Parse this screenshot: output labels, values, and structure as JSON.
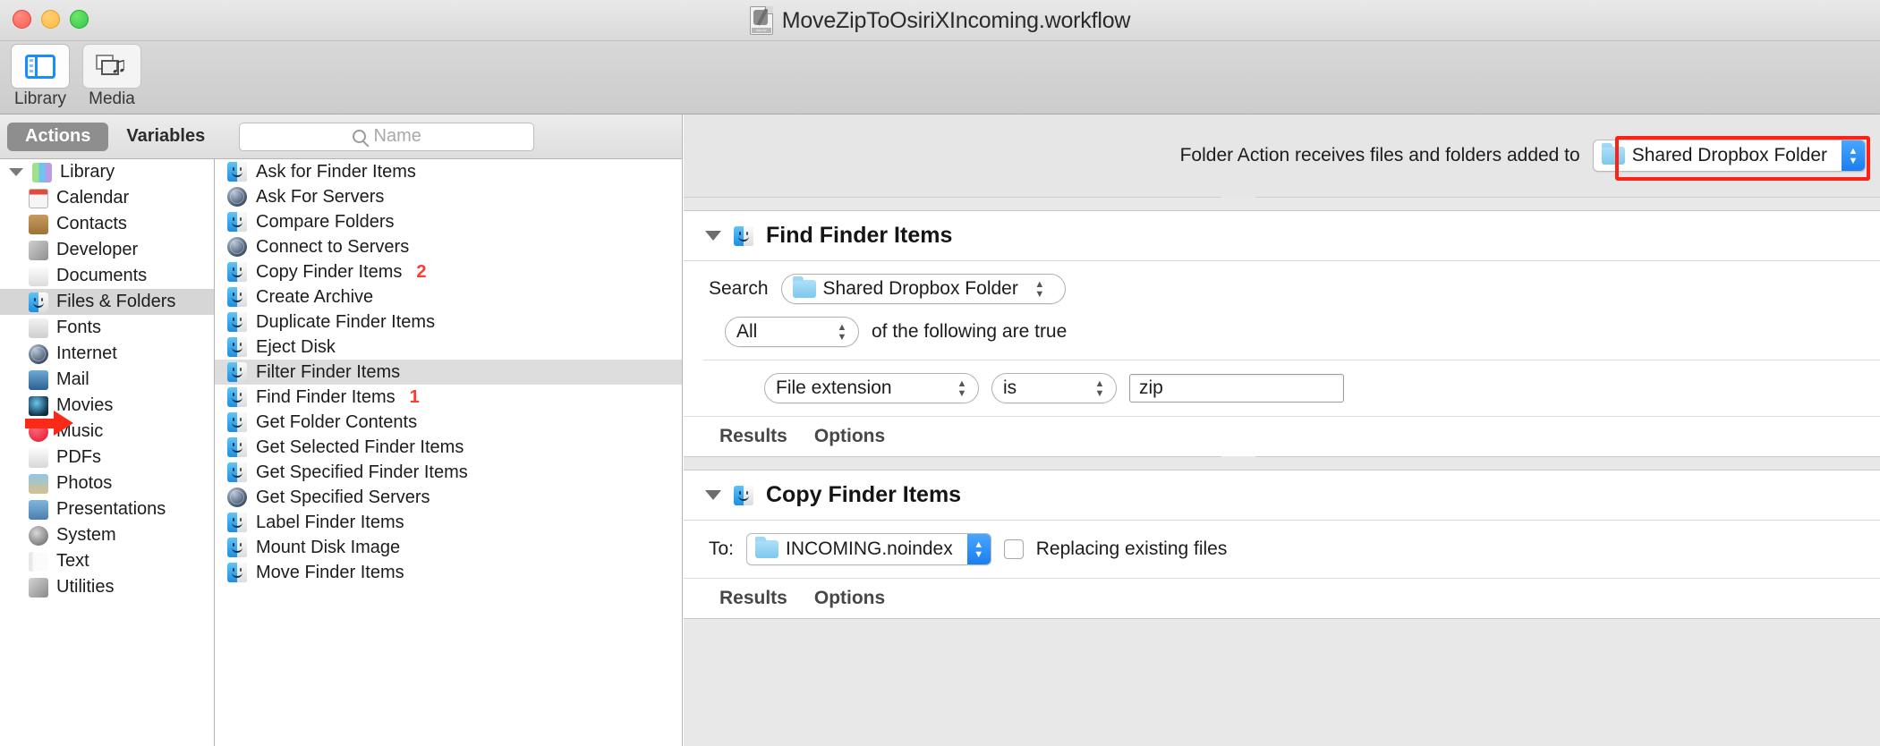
{
  "window": {
    "title": "MoveZipToOsiriXIncoming.workflow",
    "doc_icon": "workflow-document-icon",
    "traffic_lights": [
      "close-button",
      "minimize-button",
      "zoom-button"
    ]
  },
  "toolbar": {
    "items": [
      {
        "label": "Library",
        "icon": "library-panel-icon",
        "active": true
      },
      {
        "label": "Media",
        "icon": "media-browser-icon",
        "active": false
      }
    ]
  },
  "library": {
    "tabs": [
      {
        "label": "Actions",
        "selected": true
      },
      {
        "label": "Variables",
        "selected": false
      }
    ],
    "search": {
      "placeholder": "Name",
      "value": "",
      "icon": "search-icon"
    },
    "categories": [
      {
        "label": "Library",
        "icon": "library-books-icon",
        "root": true,
        "selected": false
      },
      {
        "label": "Calendar",
        "icon": "calendar-icon",
        "selected": false
      },
      {
        "label": "Contacts",
        "icon": "contacts-icon",
        "selected": false
      },
      {
        "label": "Developer",
        "icon": "developer-tools-icon",
        "selected": false
      },
      {
        "label": "Documents",
        "icon": "documents-icon",
        "selected": false
      },
      {
        "label": "Files & Folders",
        "icon": "finder-icon",
        "selected": true,
        "pointer": true
      },
      {
        "label": "Fonts",
        "icon": "fonts-icon",
        "selected": false
      },
      {
        "label": "Internet",
        "icon": "globe-icon",
        "selected": false
      },
      {
        "label": "Mail",
        "icon": "mail-photo-icon",
        "selected": false
      },
      {
        "label": "Movies",
        "icon": "quicktime-icon",
        "selected": false
      },
      {
        "label": "Music",
        "icon": "itunes-icon",
        "selected": false
      },
      {
        "label": "PDFs",
        "icon": "pdf-icon",
        "selected": false
      },
      {
        "label": "Photos",
        "icon": "photos-icon",
        "selected": false
      },
      {
        "label": "Presentations",
        "icon": "keynote-icon",
        "selected": false
      },
      {
        "label": "System",
        "icon": "system-prefs-icon",
        "selected": false
      },
      {
        "label": "Text",
        "icon": "textedit-icon",
        "selected": false
      },
      {
        "label": "Utilities",
        "icon": "utilities-icon",
        "selected": false
      }
    ],
    "actions": [
      {
        "label": "Ask for Finder Items",
        "icon": "finder-icon",
        "selected": false,
        "mark": ""
      },
      {
        "label": "Ask For Servers",
        "icon": "globe-icon",
        "selected": false,
        "mark": ""
      },
      {
        "label": "Compare Folders",
        "icon": "finder-icon",
        "selected": false,
        "mark": ""
      },
      {
        "label": "Connect to Servers",
        "icon": "globe-icon",
        "selected": false,
        "mark": ""
      },
      {
        "label": "Copy Finder Items",
        "icon": "finder-icon",
        "selected": false,
        "mark": "2"
      },
      {
        "label": "Create Archive",
        "icon": "finder-icon",
        "selected": false,
        "mark": ""
      },
      {
        "label": "Duplicate Finder Items",
        "icon": "finder-icon",
        "selected": false,
        "mark": ""
      },
      {
        "label": "Eject Disk",
        "icon": "finder-icon",
        "selected": false,
        "mark": ""
      },
      {
        "label": "Filter Finder Items",
        "icon": "finder-icon",
        "selected": true,
        "mark": ""
      },
      {
        "label": "Find Finder Items",
        "icon": "finder-icon",
        "selected": false,
        "mark": "1"
      },
      {
        "label": "Get Folder Contents",
        "icon": "finder-icon",
        "selected": false,
        "mark": ""
      },
      {
        "label": "Get Selected Finder Items",
        "icon": "finder-icon",
        "selected": false,
        "mark": ""
      },
      {
        "label": "Get Specified Finder Items",
        "icon": "finder-icon",
        "selected": false,
        "mark": ""
      },
      {
        "label": "Get Specified Servers",
        "icon": "globe-icon",
        "selected": false,
        "mark": ""
      },
      {
        "label": "Label Finder Items",
        "icon": "finder-icon",
        "selected": false,
        "mark": ""
      },
      {
        "label": "Mount Disk Image",
        "icon": "finder-icon",
        "selected": false,
        "mark": ""
      },
      {
        "label": "Move Finder Items",
        "icon": "finder-icon",
        "selected": false,
        "mark": ""
      }
    ]
  },
  "workflow": {
    "receives": {
      "label": "Folder Action receives files and folders added to",
      "folder_value": "Shared Dropbox Folder",
      "folder_icon": "blue-folder-icon",
      "highlighted": true
    },
    "actions": [
      {
        "title": "Find Finder Items",
        "icon": "finder-icon",
        "disclosure": "triangle-down-icon",
        "search_label": "Search",
        "search_value": "Shared Dropbox Folder",
        "match_scope": "All",
        "match_suffix": "of the following are true",
        "criteria": {
          "attribute": "File extension",
          "operator": "is",
          "value": "zip"
        },
        "tabs": [
          "Results",
          "Options"
        ]
      },
      {
        "title": "Copy Finder Items",
        "icon": "finder-icon",
        "disclosure": "triangle-down-icon",
        "to_label": "To:",
        "to_value": "INCOMING.noindex",
        "replace_label": "Replacing existing files",
        "replace_checked": false,
        "tabs": [
          "Results",
          "Options"
        ]
      }
    ]
  },
  "colors": {
    "accent_blue": "#1a7ef0",
    "highlight_red": "#ff2115",
    "annotation_red": "#ff3b30",
    "selection_grey": "#d6d6d6"
  }
}
